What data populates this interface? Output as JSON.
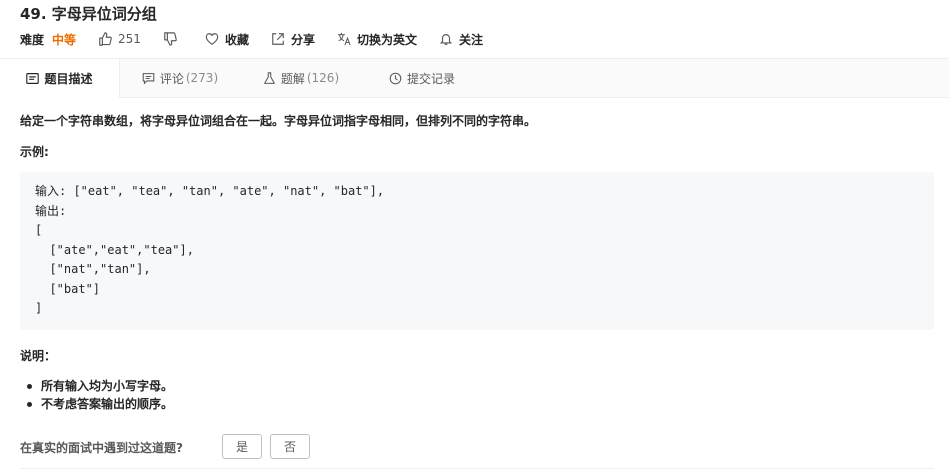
{
  "problem": {
    "title": "49. 字母异位词分组",
    "difficulty_label": "难度",
    "difficulty_value": "中等",
    "likes": "251",
    "favorite_label": "收藏",
    "share_label": "分享",
    "switch_lang_label": "切换为英文",
    "follow_label": "关注"
  },
  "tabs": [
    {
      "label": "题目描述",
      "count": ""
    },
    {
      "label": "评论",
      "count": "(273)"
    },
    {
      "label": "题解",
      "count": "(126)"
    },
    {
      "label": "提交记录",
      "count": ""
    }
  ],
  "content": {
    "description": "给定一个字符串数组，将字母异位词组合在一起。字母异位词指字母相同，但排列不同的字符串。",
    "example_label": "示例:",
    "code_lines": [
      "输入: [\"eat\", \"tea\", \"tan\", \"ate\", \"nat\", \"bat\"],",
      "输出:",
      "[",
      "  [\"ate\",\"eat\",\"tea\"],",
      "  [\"nat\",\"tan\"],",
      "  [\"bat\"]",
      "]"
    ],
    "note_label": "说明：",
    "notes": [
      "所有输入均为小写字母。",
      "不考虑答案输出的顺序。"
    ],
    "interview_question": "在真实的面试中遇到过这道题?",
    "yes_label": "是",
    "no_label": "否"
  },
  "colors": {
    "difficulty_medium": "#ef6c00",
    "tab_bar_bg": "#fafafa",
    "code_bg": "#f7f8fa"
  },
  "icons": [
    "thumbs-up-icon",
    "thumbs-down-icon",
    "heart-icon",
    "share-icon",
    "translate-icon",
    "bell-icon",
    "description-icon",
    "comment-icon",
    "flask-icon",
    "clock-icon"
  ]
}
